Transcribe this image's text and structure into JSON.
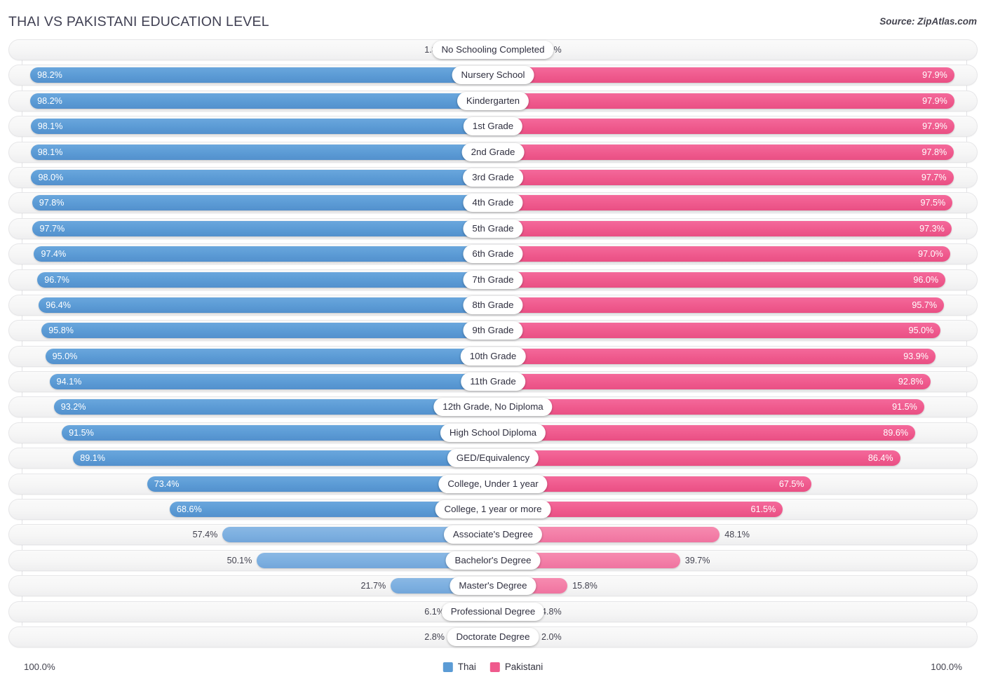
{
  "header": {
    "title": "THAI VS PAKISTANI EDUCATION LEVEL",
    "source": "Source: ZipAtlas.com"
  },
  "footer": {
    "axis_left": "100.0%",
    "axis_right": "100.0%",
    "legend": [
      {
        "label": "Thai",
        "color": "#5b9bd5"
      },
      {
        "label": "Pakistani",
        "color": "#ef5a8d"
      }
    ]
  },
  "chart_data": {
    "type": "bar",
    "title": "THAI VS PAKISTANI EDUCATION LEVEL",
    "subtitle": "Source: ZipAtlas.com",
    "orientation": "horizontal-diverging",
    "xlabel": "",
    "ylabel": "",
    "xlim": [
      0,
      100
    ],
    "axis_left_label": "100.0%",
    "axis_right_label": "100.0%",
    "grid": false,
    "legend_position": "bottom-center",
    "categories": [
      "No Schooling Completed",
      "Nursery School",
      "Kindergarten",
      "1st Grade",
      "2nd Grade",
      "3rd Grade",
      "4th Grade",
      "5th Grade",
      "6th Grade",
      "7th Grade",
      "8th Grade",
      "9th Grade",
      "10th Grade",
      "11th Grade",
      "12th Grade, No Diploma",
      "High School Diploma",
      "GED/Equivalency",
      "College, Under 1 year",
      "College, 1 year or more",
      "Associate's Degree",
      "Bachelor's Degree",
      "Master's Degree",
      "Professional Degree",
      "Doctorate Degree"
    ],
    "series": [
      {
        "name": "Thai",
        "color": "#5b9bd5",
        "values": [
          1.8,
          98.2,
          98.2,
          98.1,
          98.1,
          98.0,
          97.8,
          97.7,
          97.4,
          96.7,
          96.4,
          95.8,
          95.0,
          94.1,
          93.2,
          91.5,
          89.1,
          73.4,
          68.6,
          57.4,
          50.1,
          21.7,
          6.1,
          2.8
        ],
        "labels": [
          "1.8%",
          "98.2%",
          "98.2%",
          "98.1%",
          "98.1%",
          "98.0%",
          "97.8%",
          "97.7%",
          "97.4%",
          "96.7%",
          "96.4%",
          "95.8%",
          "95.0%",
          "94.1%",
          "93.2%",
          "91.5%",
          "89.1%",
          "73.4%",
          "68.6%",
          "57.4%",
          "50.1%",
          "21.7%",
          "6.1%",
          "2.8%"
        ]
      },
      {
        "name": "Pakistani",
        "color": "#ef5a8d",
        "values": [
          2.1,
          97.9,
          97.9,
          97.9,
          97.8,
          97.7,
          97.5,
          97.3,
          97.0,
          96.0,
          95.7,
          95.0,
          93.9,
          92.8,
          91.5,
          89.6,
          86.4,
          67.5,
          61.5,
          48.1,
          39.7,
          15.8,
          4.8,
          2.0
        ],
        "labels": [
          "2.1%",
          "97.9%",
          "97.9%",
          "97.9%",
          "97.8%",
          "97.7%",
          "97.5%",
          "97.3%",
          "97.0%",
          "96.0%",
          "95.7%",
          "95.0%",
          "93.9%",
          "92.8%",
          "91.5%",
          "89.6%",
          "86.4%",
          "67.5%",
          "61.5%",
          "48.1%",
          "39.7%",
          "15.8%",
          "4.8%",
          "2.0%"
        ]
      }
    ]
  },
  "rows": [
    {
      "label": "No Schooling Completed",
      "thai": 1.8,
      "pakistani": 2.1,
      "thai_label": "1.8%",
      "pakistani_label": "2.1%",
      "style": "short"
    },
    {
      "label": "Nursery School",
      "thai": 98.2,
      "pakistani": 97.9,
      "thai_label": "98.2%",
      "pakistani_label": "97.9%",
      "style": "full"
    },
    {
      "label": "Kindergarten",
      "thai": 98.2,
      "pakistani": 97.9,
      "thai_label": "98.2%",
      "pakistani_label": "97.9%",
      "style": "full"
    },
    {
      "label": "1st Grade",
      "thai": 98.1,
      "pakistani": 97.9,
      "thai_label": "98.1%",
      "pakistani_label": "97.9%",
      "style": "full"
    },
    {
      "label": "2nd Grade",
      "thai": 98.1,
      "pakistani": 97.8,
      "thai_label": "98.1%",
      "pakistani_label": "97.8%",
      "style": "full"
    },
    {
      "label": "3rd Grade",
      "thai": 98.0,
      "pakistani": 97.7,
      "thai_label": "98.0%",
      "pakistani_label": "97.7%",
      "style": "full"
    },
    {
      "label": "4th Grade",
      "thai": 97.8,
      "pakistani": 97.5,
      "thai_label": "97.8%",
      "pakistani_label": "97.5%",
      "style": "full"
    },
    {
      "label": "5th Grade",
      "thai": 97.7,
      "pakistani": 97.3,
      "thai_label": "97.7%",
      "pakistani_label": "97.3%",
      "style": "full"
    },
    {
      "label": "6th Grade",
      "thai": 97.4,
      "pakistani": 97.0,
      "thai_label": "97.4%",
      "pakistani_label": "97.0%",
      "style": "full"
    },
    {
      "label": "7th Grade",
      "thai": 96.7,
      "pakistani": 96.0,
      "thai_label": "96.7%",
      "pakistani_label": "96.0%",
      "style": "full"
    },
    {
      "label": "8th Grade",
      "thai": 96.4,
      "pakistani": 95.7,
      "thai_label": "96.4%",
      "pakistani_label": "95.7%",
      "style": "full"
    },
    {
      "label": "9th Grade",
      "thai": 95.8,
      "pakistani": 95.0,
      "thai_label": "95.8%",
      "pakistani_label": "95.0%",
      "style": "full"
    },
    {
      "label": "10th Grade",
      "thai": 95.0,
      "pakistani": 93.9,
      "thai_label": "95.0%",
      "pakistani_label": "93.9%",
      "style": "full"
    },
    {
      "label": "11th Grade",
      "thai": 94.1,
      "pakistani": 92.8,
      "thai_label": "94.1%",
      "pakistani_label": "92.8%",
      "style": "full"
    },
    {
      "label": "12th Grade, No Diploma",
      "thai": 93.2,
      "pakistani": 91.5,
      "thai_label": "93.2%",
      "pakistani_label": "91.5%",
      "style": "full"
    },
    {
      "label": "High School Diploma",
      "thai": 91.5,
      "pakistani": 89.6,
      "thai_label": "91.5%",
      "pakistani_label": "89.6%",
      "style": "full"
    },
    {
      "label": "GED/Equivalency",
      "thai": 89.1,
      "pakistani": 86.4,
      "thai_label": "89.1%",
      "pakistani_label": "86.4%",
      "style": "full"
    },
    {
      "label": "College, Under 1 year",
      "thai": 73.4,
      "pakistani": 67.5,
      "thai_label": "73.4%",
      "pakistani_label": "67.5%",
      "style": "full"
    },
    {
      "label": "College, 1 year or more",
      "thai": 68.6,
      "pakistani": 61.5,
      "thai_label": "68.6%",
      "pakistani_label": "61.5%",
      "style": "full"
    },
    {
      "label": "Associate's Degree",
      "thai": 57.4,
      "pakistani": 48.1,
      "thai_label": "57.4%",
      "pakistani_label": "48.1%",
      "style": "mid"
    },
    {
      "label": "Bachelor's Degree",
      "thai": 50.1,
      "pakistani": 39.7,
      "thai_label": "50.1%",
      "pakistani_label": "39.7%",
      "style": "mid"
    },
    {
      "label": "Master's Degree",
      "thai": 21.7,
      "pakistani": 15.8,
      "thai_label": "21.7%",
      "pakistani_label": "15.8%",
      "style": "mid"
    },
    {
      "label": "Professional Degree",
      "thai": 6.1,
      "pakistani": 4.8,
      "thai_label": "6.1%",
      "pakistani_label": "4.8%",
      "style": "short"
    },
    {
      "label": "Doctorate Degree",
      "thai": 2.8,
      "pakistani": 2.0,
      "thai_label": "2.8%",
      "pakistani_label": "2.0%",
      "style": "short"
    }
  ]
}
